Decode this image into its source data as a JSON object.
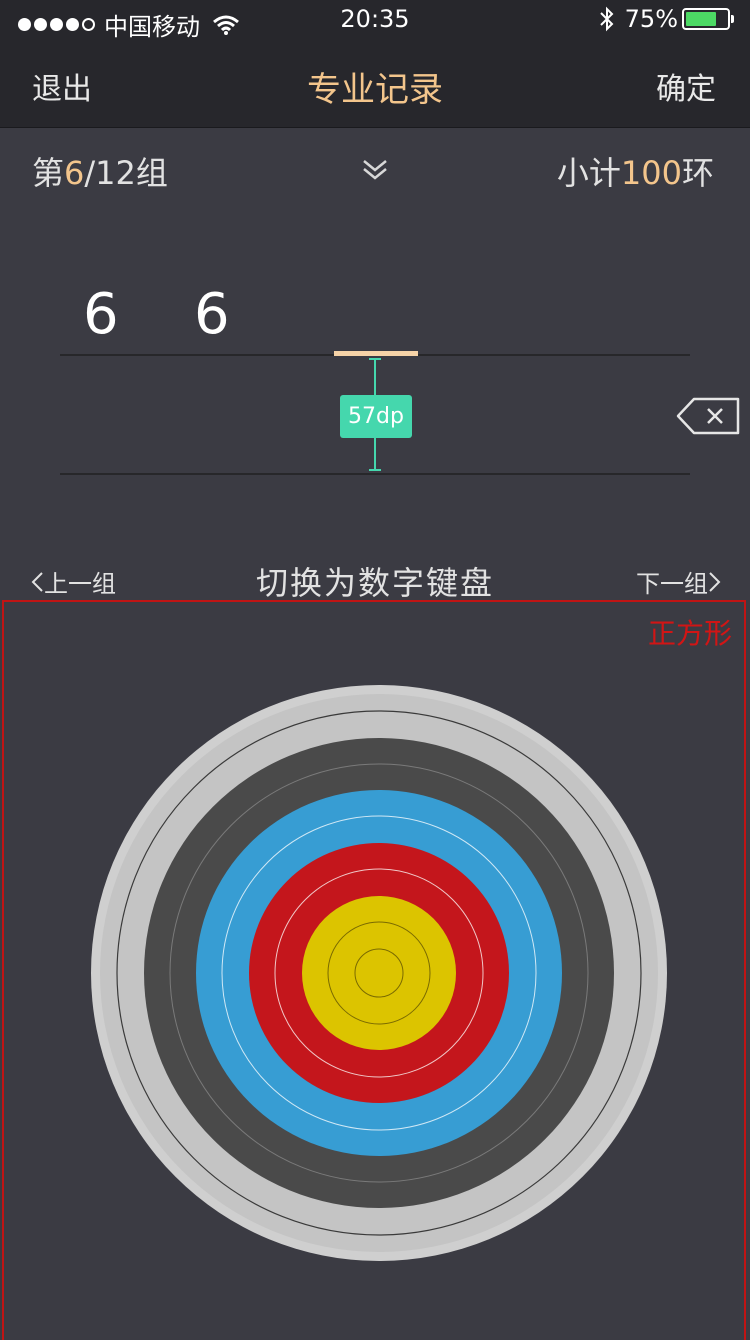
{
  "status_bar": {
    "carrier": "中国移动",
    "time": "20:35",
    "battery_text": "75%",
    "battery_level": 0.75,
    "signal_bars_filled": 4,
    "signal_bars_total": 5,
    "icons": [
      "wifi-icon",
      "bluetooth-icon",
      "battery-icon"
    ]
  },
  "nav": {
    "left_label": "退出",
    "title": "专业记录",
    "right_label": "确定"
  },
  "group": {
    "prefix": "第",
    "current": "6",
    "suffix": "/12组",
    "subtotal_prefix": "小计",
    "subtotal_value": "100",
    "subtotal_suffix": "环"
  },
  "scores": {
    "first": "6",
    "second": "6"
  },
  "annotation": {
    "dimension_label": "57dp",
    "square_label": "正方形"
  },
  "controls": {
    "prev_group": "上一组",
    "switch_keyboard": "切换为数字键盘",
    "next_group": "下一组"
  },
  "colors": {
    "accent": "#f3c58c",
    "background": "#3b3b43",
    "bar": "#27272c",
    "dimension": "#45d7ad",
    "annotation_red": "#c01414",
    "target_white": "#cfcfcf",
    "target_black": "#4a4a4a",
    "target_blue": "#379dd3",
    "target_red": "#c4161c",
    "target_gold": "#dcc400"
  }
}
